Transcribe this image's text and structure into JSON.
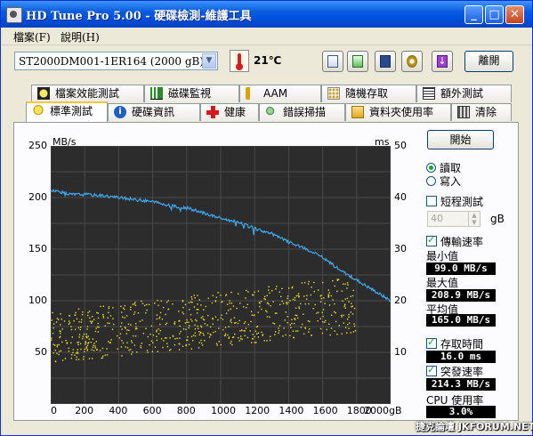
{
  "window": {
    "title": "HD Tune Pro  5.00 - 硬碟檢測-維護工具",
    "min_label": "_",
    "max_label": "□",
    "close_label": "✕"
  },
  "menu": [
    {
      "label": "檔案(F)"
    },
    {
      "label": "說明(H)"
    }
  ],
  "toolbar": {
    "drive_selected": "ST2000DM001-1ER164 (2000 gB)",
    "temperature": "21℃",
    "tools": [
      "copy-info-icon",
      "copy-screen-icon",
      "save-icon",
      "settings-icon",
      "download-icon"
    ],
    "exit_label": "離開"
  },
  "tabs_row1": [
    {
      "label": "檔案效能測試",
      "icon": "file-icon"
    },
    {
      "label": "磁碟監視",
      "icon": "monitor-icon"
    },
    {
      "label": "AAM",
      "icon": "speaker-icon"
    },
    {
      "label": "隨機存取",
      "icon": "random-access-icon"
    },
    {
      "label": "額外測試",
      "icon": "extra-tests-icon"
    }
  ],
  "tabs_row2": [
    {
      "label": "標準測試",
      "icon": "bulb-icon",
      "active": true
    },
    {
      "label": "硬碟資訊",
      "icon": "info-icon"
    },
    {
      "label": "健康",
      "icon": "health-cross-icon"
    },
    {
      "label": "錯誤掃描",
      "icon": "error-scan-icon"
    },
    {
      "label": "資料夾使用率",
      "icon": "folder-icon"
    },
    {
      "label": "清除",
      "icon": "trash-icon"
    }
  ],
  "controls": {
    "start_label": "開始",
    "read_label": "讀取",
    "write_label": "寫入",
    "mode_selected": "read",
    "short_test_label": "短程測試",
    "short_test_checked": false,
    "short_test_size": "40",
    "short_test_unit": "gB",
    "transfer_rate_label": "傳輸速率",
    "transfer_rate_checked": true,
    "min_label": "最小值",
    "min_value": "99.0 MB/s",
    "max_label": "最大值",
    "max_value": "208.9 MB/s",
    "avg_label": "平均值",
    "avg_value": "165.0 MB/s",
    "access_time_label": "存取時間",
    "access_time_checked": true,
    "access_time_value": "16.0 ms",
    "burst_rate_label": "突發速率",
    "burst_rate_checked": true,
    "burst_rate_value": "214.3 MB/s",
    "cpu_label": "CPU 使用率",
    "cpu_value": "3.0%"
  },
  "chart_data": {
    "type": "line",
    "y_left_label": "MB/s",
    "y_right_label": "ms",
    "ylim_left": [
      0,
      250
    ],
    "ylim_right": [
      0,
      50
    ],
    "xlim": [
      0,
      2000
    ],
    "x_unit": "gB",
    "left_ticks": [
      "250",
      "200",
      "150",
      "100",
      "50"
    ],
    "right_ticks": [
      "50",
      "40",
      "30",
      "20",
      "10"
    ],
    "x_ticks": [
      "0",
      "200",
      "400",
      "600",
      "800",
      "1000",
      "1200",
      "1400",
      "1600",
      "1800",
      "2000gB"
    ],
    "grid": true,
    "series": [
      {
        "name": "傳輸速率",
        "color": "#3fa9f5",
        "axis": "left",
        "x": [
          0,
          50,
          100,
          200,
          300,
          400,
          500,
          600,
          700,
          800,
          900,
          1000,
          1100,
          1200,
          1300,
          1400,
          1500,
          1600,
          1700,
          1800,
          1900,
          2000
        ],
        "values": [
          207,
          206,
          203,
          203,
          202,
          200,
          198,
          196,
          192,
          190,
          185,
          180,
          176,
          170,
          165,
          157,
          150,
          142,
          130,
          120,
          110,
          100
        ]
      },
      {
        "name": "存取時間",
        "color": "#e8e020",
        "axis": "right",
        "type": "scatter",
        "x_range": [
          0,
          1800
        ],
        "values_min_start": 8,
        "values_max_start": 18,
        "values_min_end": 14,
        "values_max_end": 25
      }
    ]
  },
  "watermark": "捷克論壇 JKFORUM.NET"
}
